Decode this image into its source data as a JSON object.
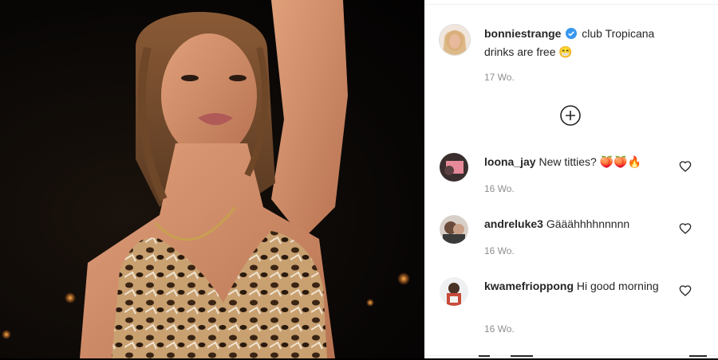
{
  "caption": {
    "username": "bonniestrange",
    "text": "club Tropicana drinks are free 😁",
    "time": "17 Wo."
  },
  "icons": {
    "verified": "verified-badge-icon",
    "load_more": "plus-circle-icon",
    "like": "heart-outline-icon"
  },
  "colors": {
    "verified": "#3897f0",
    "text": "#262626",
    "secondary": "#8e8e8e"
  },
  "comments": [
    {
      "username": "loona_jay",
      "text": "New titties? 🍑🍑🔥",
      "time": "16 Wo."
    },
    {
      "username": "andreluke3",
      "text": "Gääähhhhnnnnn",
      "time": "16 Wo."
    },
    {
      "username": "kwamefrioppong",
      "text": "Hi good morning",
      "time": "16 Wo."
    }
  ]
}
